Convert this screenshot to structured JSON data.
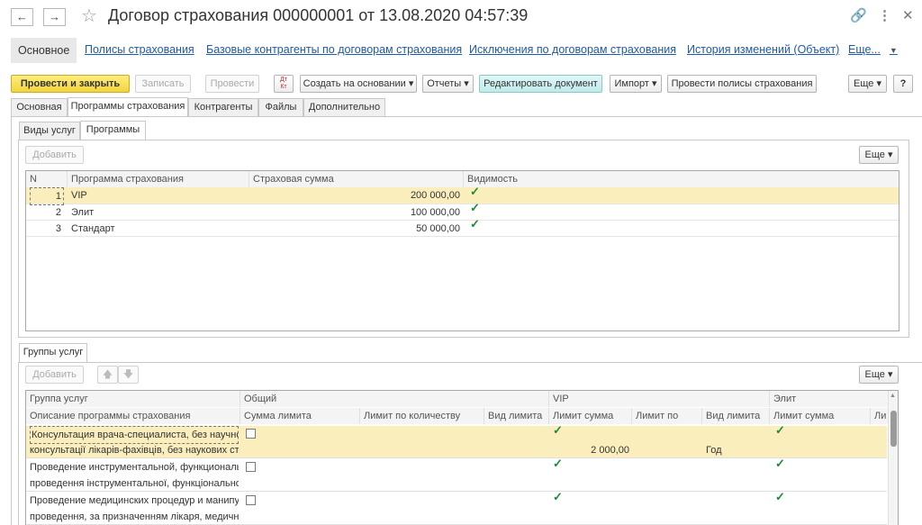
{
  "window": {
    "title": "Договор страхования 000000001 от 13.08.2020 04:57:39"
  },
  "sections": {
    "active": "Основное",
    "links": [
      "Полисы страхования",
      "Базовые контрагенты по договорам страхования",
      "Исключения по договорам страхования",
      "История изменений (Объект)"
    ],
    "more": "Еще..."
  },
  "toolbar": {
    "post_close": "Провести и закрыть",
    "save": "Записать",
    "post": "Провести",
    "dt_kt": "Дт Кт",
    "create_based": "Создать на основании",
    "reports": "Отчеты",
    "edit_doc": "Редактировать документ",
    "import": "Импорт",
    "post_policies": "Провести полисы страхования",
    "more": "Еще",
    "help": "?"
  },
  "main_tabs": [
    "Основная",
    "Программы страхования",
    "Контрагенты",
    "Файлы",
    "Дополнительно"
  ],
  "sub_tabs": [
    "Виды услуг",
    "Программы"
  ],
  "programs": {
    "add": "Добавить",
    "more": "Еще",
    "columns": [
      "N",
      "Программа страхования",
      "Страховая сумма",
      "Видимость"
    ],
    "rows": [
      {
        "n": "1",
        "name": "VIP",
        "sum": "200 000,00",
        "visible": true
      },
      {
        "n": "2",
        "name": "Элит",
        "sum": "100 000,00",
        "visible": true
      },
      {
        "n": "3",
        "name": "Стандарт",
        "sum": "50 000,00",
        "visible": true
      }
    ]
  },
  "groups": {
    "tab": "Группы услуг",
    "add": "Добавить",
    "more": "Еще",
    "head1": [
      "Группа услуг",
      "Общий",
      "VIP",
      "Элит"
    ],
    "head2": [
      "Описание программы страхования",
      "Сумма лимита",
      "Лимит по количеству",
      "Вид лимита",
      "Лимит сумма",
      "Лимит по",
      "Вид лимита",
      "Лимит сумма",
      "Ли"
    ],
    "rows": [
      {
        "l1": "Консультация врача-специалиста, без научной...",
        "l2": "консультації лікарів-фахівців, без наукових сту...",
        "common_sum": false,
        "vip_sum": true,
        "elite_sum": true,
        "vip_limit_value": "2 000,00",
        "vip_limit_type": "Год"
      },
      {
        "l1": "Проведение инструментальной, функциональн...",
        "l2": "проведення інструментальної, функціональної ...",
        "common_sum": false,
        "vip_sum": true,
        "elite_sum": true
      },
      {
        "l1": "Проведение медицинских процедур и манипул...",
        "l2": "проведення, за призначенням лікаря, медични...",
        "common_sum": false,
        "vip_sum": true,
        "elite_sum": true
      }
    ]
  }
}
